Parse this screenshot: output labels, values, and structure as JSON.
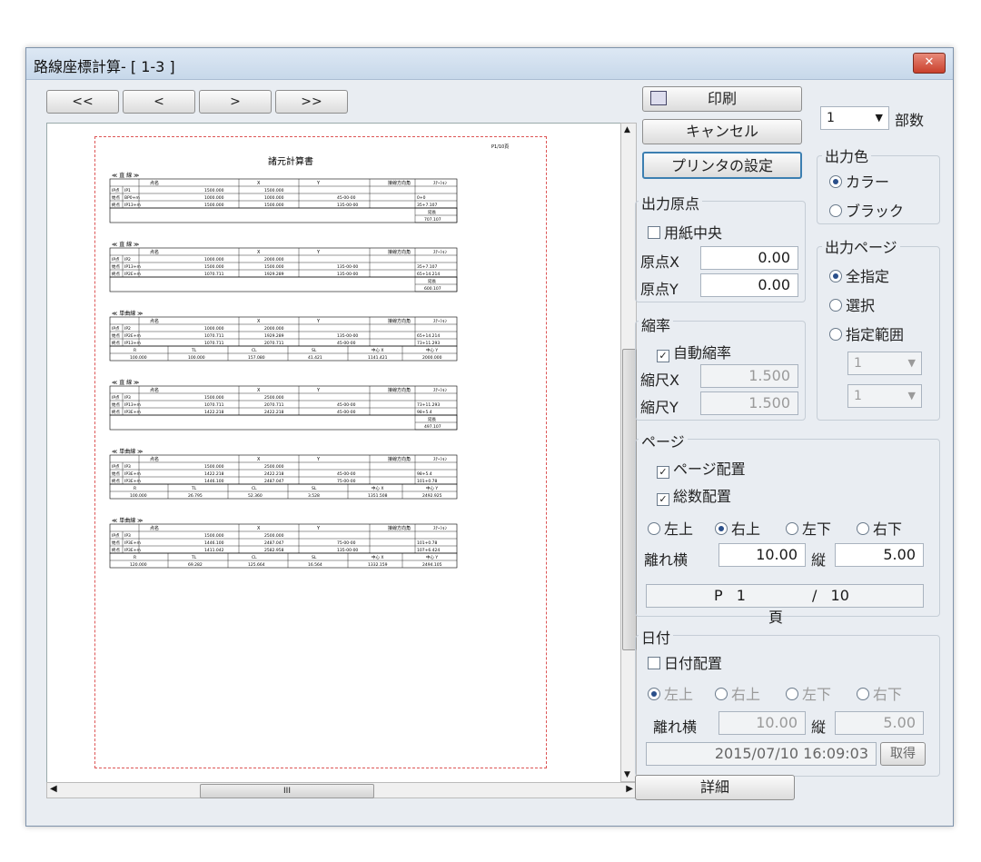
{
  "window": {
    "title": "路線座標計算- [ 1-3 ]",
    "close": "✕"
  },
  "nav": {
    "first": "<<",
    "prev": "<",
    "next": ">",
    "last": ">>"
  },
  "buttons": {
    "print": "印刷",
    "cancel": "キャンセル",
    "printer_settings": "プリンタの設定",
    "details": "詳細",
    "acquire": "取得"
  },
  "copies": {
    "value": "1",
    "label": "部数"
  },
  "output_color": {
    "title": "出力色",
    "options": [
      "カラー",
      "ブラック"
    ],
    "selected": 0
  },
  "output_origin": {
    "title": "出力原点",
    "center_label": "用紙中央",
    "x_label": "原点X",
    "x_value": "0.00",
    "y_label": "原点Y",
    "y_value": "0.00"
  },
  "output_page": {
    "title": "出力ページ",
    "options": [
      "全指定",
      "選択",
      "指定範囲"
    ],
    "selected": 0,
    "range_from": "1",
    "range_to": "1"
  },
  "scale": {
    "title": "縮率",
    "auto_label": "自動縮率",
    "x_label": "縮尺X",
    "x_value": "1.500",
    "y_label": "縮尺Y",
    "y_value": "1.500"
  },
  "page": {
    "title": "ページ",
    "page_layout": "ページ配置",
    "total_layout": "総数配置",
    "positions": [
      "左上",
      "右上",
      "左下",
      "右下"
    ],
    "selected": 1,
    "offset_h_label": "離れ横",
    "offset_h": "10.00",
    "offset_v_label": "縦",
    "offset_v": "5.00",
    "p_prefix": "P",
    "page_num": "1",
    "slash": "/",
    "total": "10",
    "suffix": "頁"
  },
  "date": {
    "title": "日付",
    "date_layout": "日付配置",
    "positions": [
      "左上",
      "右上",
      "左下",
      "右下"
    ],
    "selected": 0,
    "offset_h_label": "離れ横",
    "offset_h": "10.00",
    "offset_v_label": "縦",
    "offset_v": "5.00",
    "datetime": "2015/07/10 16:09:03"
  },
  "preview": {
    "page_no": "P1/10頁",
    "doc_title": "諸元計算書",
    "headers": [
      "点名",
      "X",
      "Y",
      "接線方向角",
      "ｽﾃｰｼｮﾝ"
    ],
    "curve_headers": [
      "R",
      "TL",
      "CL",
      "SL",
      "中心 X",
      "中心 Y"
    ],
    "sections": [
      {
        "title": "≪ 直 線 ≫",
        "rows": [
          [
            "IP点",
            "IP1",
            "1500.000",
            "1500.000",
            "",
            ""
          ],
          [
            "始点",
            "BP0+m",
            "1000.000",
            "1000.000",
            "45-00-00",
            "0+0"
          ],
          [
            "終点",
            "IP13+m",
            "1500.000",
            "1500.000",
            "135-00-00",
            "35+7.107"
          ]
        ],
        "length_label": "延長",
        "length": "707.107"
      },
      {
        "title": "≪ 直 線 ≫",
        "rows": [
          [
            "IP点",
            "IP2",
            "1000.000",
            "2000.000",
            "",
            ""
          ],
          [
            "始点",
            "IP13+m",
            "1500.000",
            "1500.000",
            "135-00-00",
            "35+7.107"
          ],
          [
            "終点",
            "IP2E+m",
            "1070.711",
            "1929.289",
            "135-00-00",
            "65+14.214"
          ]
        ],
        "length_label": "延長",
        "length": "600.107"
      },
      {
        "title": "≪ 単曲線 ≫",
        "rows": [
          [
            "IP点",
            "IP2",
            "1000.000",
            "2000.000",
            "",
            ""
          ],
          [
            "始点",
            "IP2E+m",
            "1070.711",
            "1929.289",
            "135-00-00",
            "65+14.214"
          ],
          [
            "終点",
            "IP13+m",
            "1070.711",
            "2070.711",
            "45-00-00",
            "73+11.293"
          ]
        ],
        "curve": [
          "100.000",
          "100.000",
          "157.080",
          "41.421",
          "1141.421",
          "2000.000"
        ]
      },
      {
        "title": "≪ 直 線 ≫",
        "rows": [
          [
            "IP点",
            "IP3",
            "1500.000",
            "2500.000",
            "",
            ""
          ],
          [
            "始点",
            "IP13+m",
            "1070.711",
            "2070.711",
            "45-00-00",
            "73+11.293"
          ],
          [
            "終点",
            "IP3E+m",
            "1422.218",
            "2422.218",
            "45-00-00",
            "98+5.4"
          ]
        ],
        "length_label": "延長",
        "length": "497.107"
      },
      {
        "title": "≪ 単曲線 ≫",
        "rows": [
          [
            "IP点",
            "IP3",
            "1500.000",
            "2500.000",
            "",
            ""
          ],
          [
            "始点",
            "IP3E+m",
            "1422.218",
            "2422.218",
            "45-00-00",
            "98+5.4"
          ],
          [
            "終点",
            "IP3E+m",
            "1446.100",
            "2487.047",
            "75-00-00",
            "101+0.78"
          ]
        ],
        "curve": [
          "100.000",
          "26.795",
          "52.360",
          "3.528",
          "1351.508",
          "2492.925"
        ]
      },
      {
        "title": "≪ 単曲線 ≫",
        "rows": [
          [
            "IP点",
            "IP3",
            "1500.000",
            "2500.000",
            "",
            ""
          ],
          [
            "始点",
            "IP3E+m",
            "1446.100",
            "2487.047",
            "75-00-00",
            "101+0.78"
          ],
          [
            "終点",
            "IP3E+m",
            "1411.042",
            "2582.958",
            "135-00-00",
            "107+6.424"
          ]
        ],
        "curve": [
          "120.000",
          "69.282",
          "125.664",
          "16.564",
          "1332.159",
          "2494.105"
        ]
      }
    ]
  },
  "scrollbar": {
    "grip": "III"
  },
  "colors": {
    "window_bg": "#e9edf2",
    "title_grad": "#c7d8ea",
    "close": "#c9402c",
    "dashed_border": "#dd5555"
  }
}
